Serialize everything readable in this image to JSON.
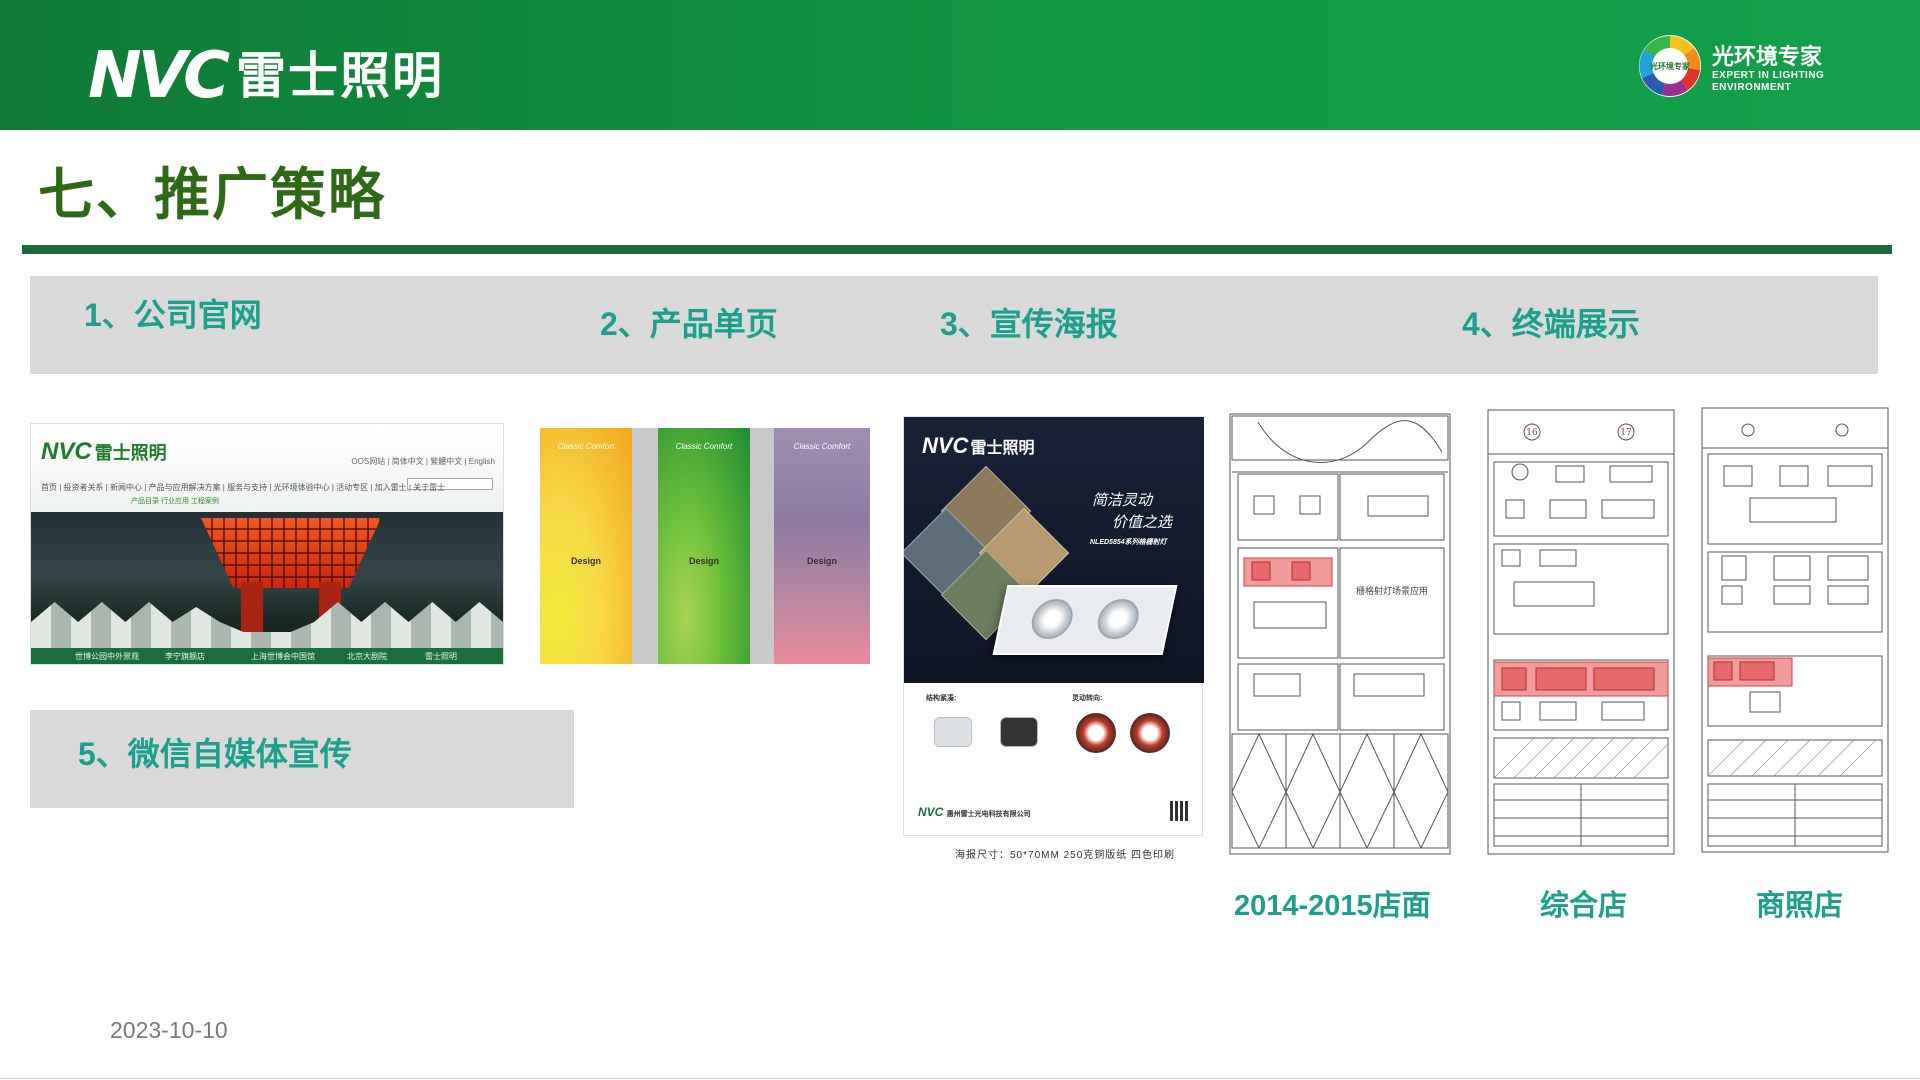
{
  "header": {
    "logo_mark": "NVC",
    "logo_cn": "雷士照明",
    "badge_inner": "光环境专家",
    "badge_cn": "光环境专家",
    "badge_en_1": "EXPERT IN LIGHTING",
    "badge_en_2": "ENVIRONMENT"
  },
  "page": {
    "title": "七、推广策略",
    "date": "2023-10-10"
  },
  "sections": [
    "1、公司官网",
    "2、产品单页",
    "3、宣传海报",
    "4、终端展示",
    "5、微信自媒体宣传"
  ],
  "website": {
    "logo_mark": "NVC",
    "logo_cn": "雷士照明",
    "lang": "OOS网站 | 简体中文 | 繁體中文 | English",
    "nav": "首页 | 投资者关系 | 新闻中心 | 产品与应用解决方案 | 服务与支持 | 光环境体验中心 | 活动专区 | 加入雷士 | 关于雷士",
    "sub": "产品目录    行业应用    工程案例",
    "search": "搜索",
    "bar_items": [
      "世博公园中外景观",
      "李宁旗舰店",
      "上海世博会中国馆",
      "北京大剧院",
      "雷士照明"
    ]
  },
  "product_pages": {
    "tag": "Classic Comfort",
    "design": "Design"
  },
  "poster": {
    "logo_mark": "NVC",
    "logo_cn": "雷士照明",
    "slogan_1": "简洁灵动",
    "slogan_2": "价值之选",
    "model": "NLED5854系列格栅射灯",
    "section_1": "结构紧凑:",
    "section_2": "灵动转向:",
    "company": "惠州雷士光电科技有限公司",
    "caption": "海报尺寸：50*70MM  250克铜版纸  四色印刷"
  },
  "stores": {
    "label_1": "2014-2015店面",
    "label_2": "综合店",
    "label_3": "商照店",
    "d1_text": "栅格射灯场景应用",
    "d2_circles": [
      "16",
      "17"
    ]
  },
  "colors": {
    "header_green": "#119a43",
    "title_green": "#2e6a16",
    "rule_green": "#1c6b3c",
    "label_teal": "#1aa08c",
    "band_gray": "#d9d9d9",
    "highlight_red": "#f29b9b"
  }
}
